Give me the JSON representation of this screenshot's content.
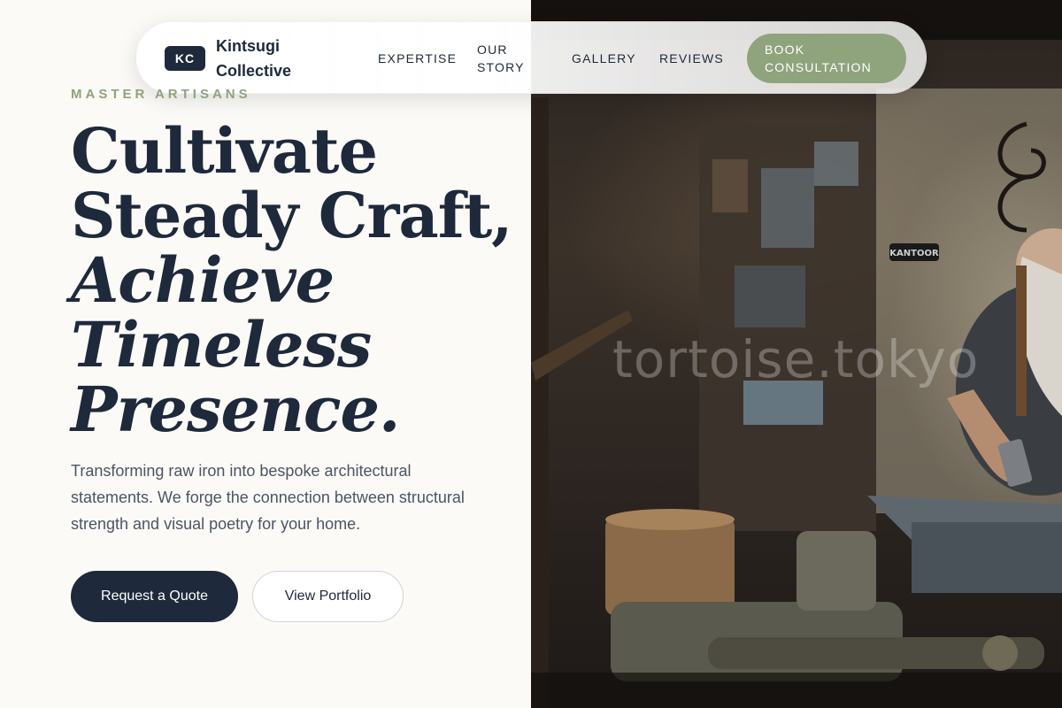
{
  "brand": {
    "badge": "KC",
    "name": "Kintsugi Collective"
  },
  "nav": {
    "links": [
      "EXPERTISE",
      "OUR STORY",
      "GALLERY",
      "REVIEWS"
    ],
    "cta": "BOOK CONSULTATION"
  },
  "hero": {
    "eyebrow": "MASTER ARTISANS",
    "headline_lines": [
      "Cultivate",
      "Steady Craft,"
    ],
    "headline_italic_lines": [
      "Achieve",
      "Timeless",
      "Presence."
    ],
    "lede": "Transforming raw iron into bespoke architectural statements. We forge the connection between structural strength and visual poetry for your home.",
    "primary_button": "Request a Quote",
    "secondary_button": "View Portfolio"
  },
  "photo": {
    "sign_text": "KANTOOR",
    "watermark": "tortoise.tokyo"
  },
  "colors": {
    "navy": "#1e293b",
    "sage": "#8fa37d",
    "background": "#fbfaf7"
  }
}
